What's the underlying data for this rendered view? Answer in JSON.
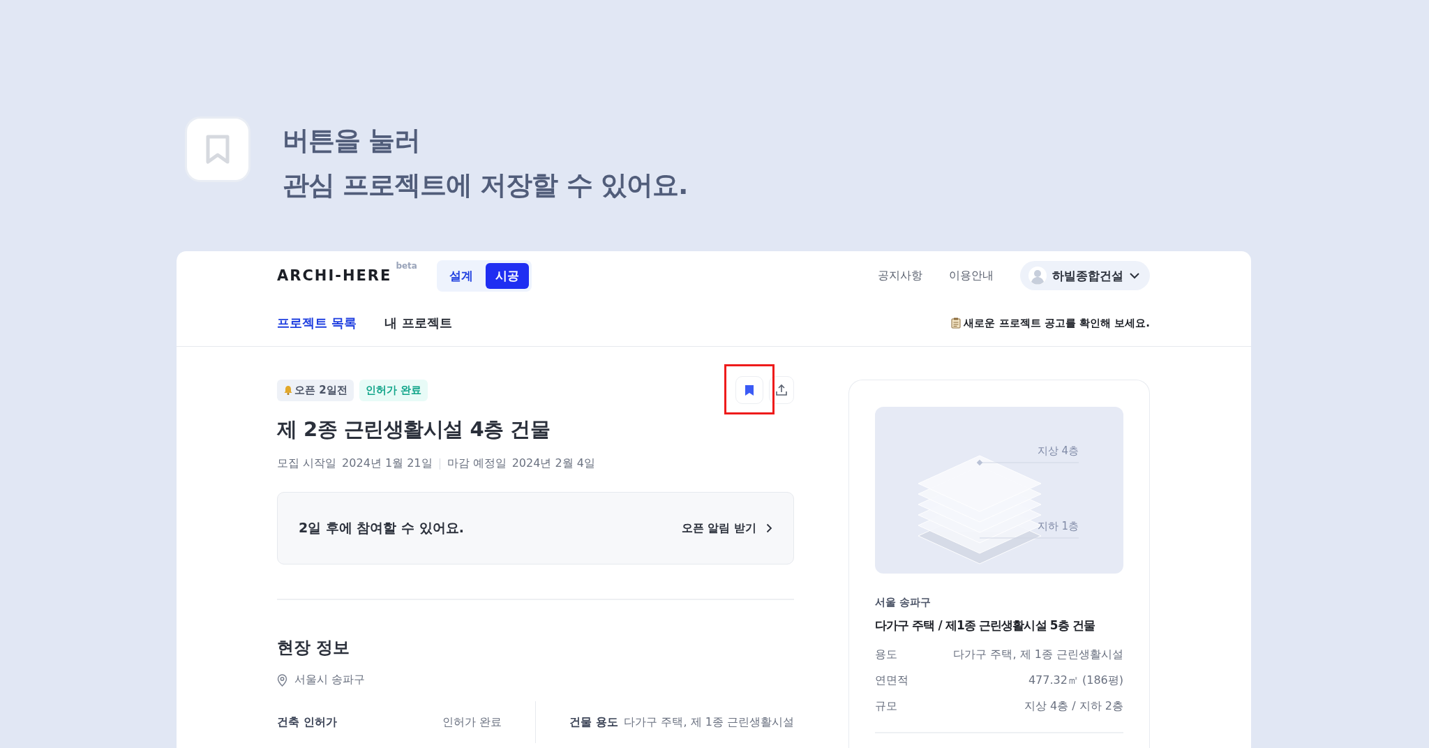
{
  "hero": {
    "lines": [
      "버튼을 눌러",
      "관심 프로젝트에 저장할 수 있어요."
    ]
  },
  "header": {
    "logo": "ARCHI-HERE",
    "logo_tag": "beta",
    "modes": [
      {
        "label": "설계",
        "selected": false
      },
      {
        "label": "시공",
        "selected": true
      }
    ],
    "links": [
      "공지사항",
      "이용안내"
    ],
    "account": "하빌종합건설"
  },
  "tabs": [
    {
      "label": "프로젝트 목록",
      "selected": true
    },
    {
      "label": "내 프로젝트",
      "selected": false
    }
  ],
  "announcement": "새로운 프로젝트 공고를 확인해 보세요.",
  "project": {
    "badges": [
      {
        "kind": "countdown",
        "label": "오픈 2일전"
      },
      {
        "kind": "status",
        "label": "인허가 완료"
      }
    ],
    "bookmarked": true,
    "highlighted": true,
    "title": "제 2종 근린생활시설 4층 건물",
    "dates": [
      {
        "label": "모집 시작일",
        "value": "2024년 1월 21일"
      },
      {
        "label": "마감 예정일",
        "value": "2024년 2월 4일"
      }
    ],
    "notice": {
      "message": "2일 후에 참여할 수 있어요.",
      "action": "오픈 알림 받기"
    },
    "section_title": "현장 정보",
    "location": "서울시 송파구",
    "facts": [
      {
        "label": "건축 인허가",
        "value": "인허가 완료"
      },
      {
        "label": "건물 용도",
        "value": "다가구 주택, 제 1종 근린생활시설"
      }
    ]
  },
  "summary": {
    "floor_labels": [
      "지상 4층",
      "지하 1층"
    ],
    "region": "서울 송파구",
    "title": "다가구 주택 / 제1종 근린생활시설 5층 건물",
    "specs": [
      {
        "label": "용도",
        "value": "다가구 주택, 제 1종 근린생활시설"
      },
      {
        "label": "연면적",
        "value": "477.32㎡ (186평)"
      },
      {
        "label": "규모",
        "value": "지상 4층 / 지하 2층"
      }
    ]
  }
}
